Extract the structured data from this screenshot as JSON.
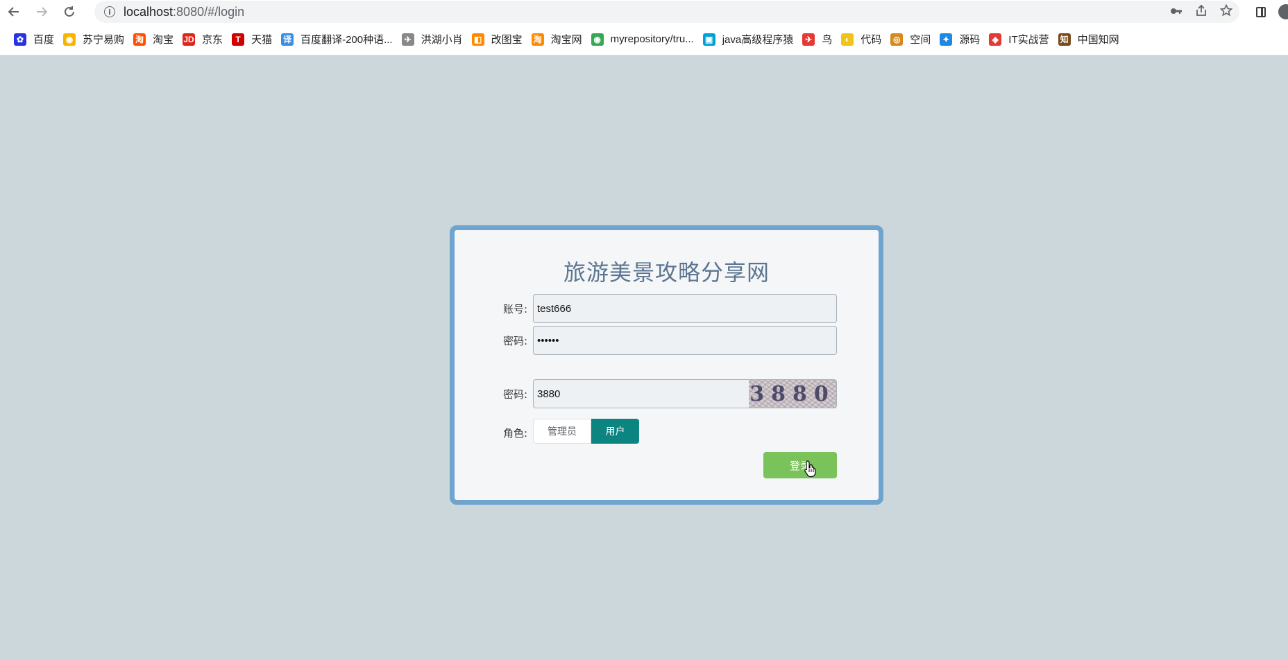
{
  "browser": {
    "url_host": "localhost",
    "url_path": ":8080/#/login",
    "bookmarks": [
      {
        "label": "百度",
        "icon": "baidu-icon",
        "color": "#2932e1",
        "glyph": "✿"
      },
      {
        "label": "苏宁易购",
        "icon": "suning-icon",
        "color": "#f7b500",
        "glyph": "◉"
      },
      {
        "label": "淘宝",
        "icon": "taobao-icon",
        "color": "#ff5000",
        "glyph": "淘"
      },
      {
        "label": "京东",
        "icon": "jd-icon",
        "color": "#e1251b",
        "glyph": "JD"
      },
      {
        "label": "天猫",
        "icon": "tmall-icon",
        "color": "#d00000",
        "glyph": "T"
      },
      {
        "label": "百度翻译-200种语...",
        "icon": "baidu-translate-icon",
        "color": "#3a8ee6",
        "glyph": "译"
      },
      {
        "label": "洪湖小肖",
        "icon": "hawk-icon",
        "color": "#888888",
        "glyph": "✈"
      },
      {
        "label": "改图宝",
        "icon": "gaitubao-icon",
        "color": "#ff8a00",
        "glyph": "◧"
      },
      {
        "label": "淘宝网",
        "icon": "taobao-net-icon",
        "color": "#ff8a00",
        "glyph": "淘"
      },
      {
        "label": "myrepository/tru...",
        "icon": "chrome-icon",
        "color": "#34a853",
        "glyph": "◉"
      },
      {
        "label": "java高级程序猿",
        "icon": "bilibili-icon",
        "color": "#00a1d6",
        "glyph": "▣"
      },
      {
        "label": "鸟",
        "icon": "bird-icon",
        "color": "#e53935",
        "glyph": "✈"
      },
      {
        "label": "代码",
        "icon": "code-icon",
        "color": "#f0c419",
        "glyph": "◐"
      },
      {
        "label": "空间",
        "icon": "qzone-icon",
        "color": "#d48a1c",
        "glyph": "◎"
      },
      {
        "label": "源码",
        "icon": "source-icon",
        "color": "#1e88e5",
        "glyph": "✦"
      },
      {
        "label": "IT实战营",
        "icon": "itzhanying-icon",
        "color": "#e53935",
        "glyph": "◈"
      },
      {
        "label": "中国知网",
        "icon": "cnki-icon",
        "color": "#7a4a1a",
        "glyph": "知"
      }
    ]
  },
  "login": {
    "title": "旅游美景攻略分享网",
    "account_label": "账号:",
    "account_value": "test666",
    "password_label": "密码:",
    "password_value": "••••••",
    "captcha_label": "密码:",
    "captcha_value": "3880",
    "captcha_image_text": "3880",
    "role_label": "角色:",
    "role_admin": "管理员",
    "role_user": "用户",
    "login_button": "登录"
  },
  "colors": {
    "background": "#ccd7db",
    "card_border": "#6fa4cf",
    "title": "#5b7591",
    "role_selected": "#0c8480",
    "login_button": "#7ac25a"
  }
}
